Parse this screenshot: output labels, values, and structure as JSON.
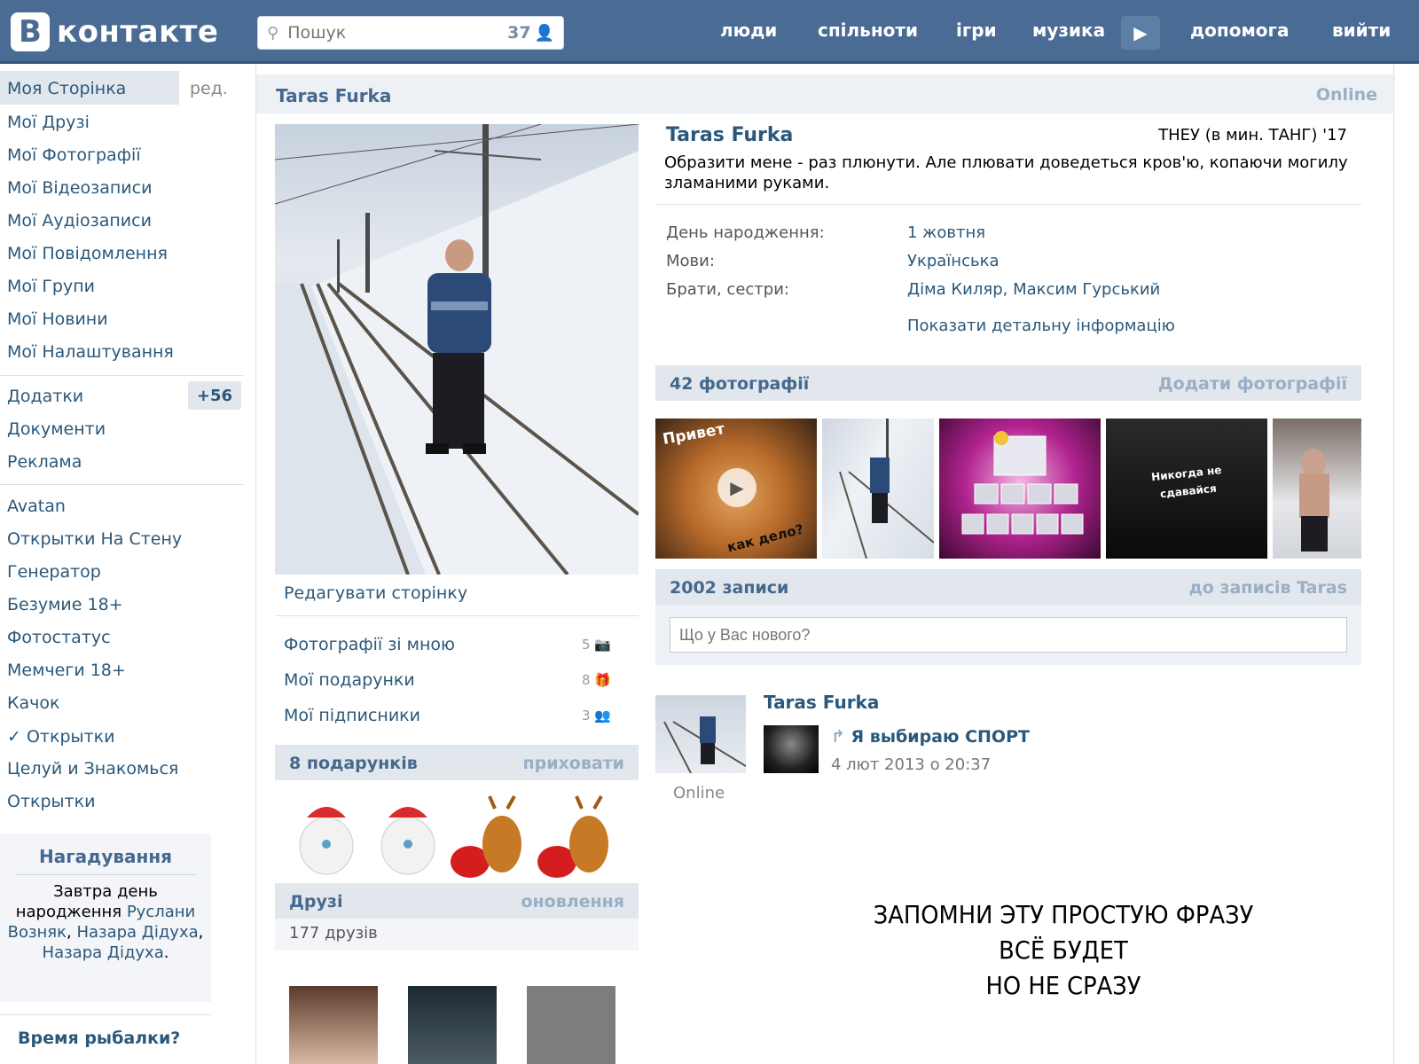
{
  "header": {
    "logo_letter": "В",
    "logo_text": "контакте",
    "search_placeholder": "Пошук",
    "search_count": "37",
    "nav": [
      "люди",
      "спільноти",
      "ігри",
      "музика",
      "допомога",
      "вийти"
    ]
  },
  "sidebar": {
    "items": [
      "Моя Сторінка",
      "Мої Друзі",
      "Мої Фотографії",
      "Мої Відеозаписи",
      "Мої Аудіозаписи",
      "Мої Повідомлення",
      "Мої Групи",
      "Мої Новини",
      "Мої Налаштування"
    ],
    "edit_label": "ред.",
    "apps": [
      "Додатки",
      "Документи",
      "Реклама"
    ],
    "apps_badge": "+56",
    "extra": [
      "Avatan",
      "Открытки На Стену",
      "Генератор",
      "Безумие 18+",
      "Фотостатус",
      "Мемчеги 18+",
      "Качок",
      "✓ Открытки",
      "Целуй и Знакомься",
      "Открытки"
    ],
    "reminder": {
      "title": "Нагадування",
      "text_1": "Завтра день народження",
      "name_1": "Руслани Возняк",
      "sep": ", ",
      "name_2": "Назара Дідуха",
      "name_3": "Назара Дідуха",
      "end": "."
    },
    "bottom_title": "Время рыбалки?"
  },
  "profile": {
    "title": "Taras Furka",
    "online": "Online",
    "name": "Taras Furka",
    "education": "ТНЕУ (в мин. ТАНГ) '17",
    "status": "Образити мене - раз плюнути. Але плювати доведеться кров'ю, копаючи могилу зламаними руками.",
    "info": [
      {
        "label": "День народження:",
        "value": "1 жовтня"
      },
      {
        "label": "Мови:",
        "value": "Українська"
      },
      {
        "label": "Брати, сестри:",
        "value": "Діма Киляр, Максим Гурський"
      }
    ],
    "show_more": "Показати детальну інформацію",
    "edit_page": "Редагувати сторінку",
    "links": [
      {
        "label": "Фотографії зі мною",
        "count": "5"
      },
      {
        "label": "Мої подарунки",
        "count": "8"
      },
      {
        "label": "Мої підписники",
        "count": "3"
      }
    ],
    "gifts": {
      "title": "8 подарунків",
      "action": "приховати"
    },
    "friends": {
      "title": "Друзі",
      "action": "оновлення",
      "count": "177 друзів"
    }
  },
  "photos": {
    "title": "42 фотографії",
    "action": "Додати фотографії",
    "thumb1_text": "Привет",
    "thumb1_text2": "как дело?",
    "thumb4_text": "Никогда не сдавайся"
  },
  "wall": {
    "title": "2002 записи",
    "action": "до записів Taras",
    "input_placeholder": "Що у Вас нового?",
    "post": {
      "author": "Taras Furka",
      "online": "Online",
      "shared": "Я выбираю СПОРТ",
      "time": "4 лют 2013 о 20:37"
    }
  },
  "quote": {
    "line1": "ЗАПОМНИ ЭТУ ПРОСТУЮ ФРАЗУ",
    "line2": "ВСЁ БУДЕТ",
    "line3": "НО НЕ СРАЗУ"
  },
  "colors": {
    "header": "#4a6c94",
    "link": "#2b587a",
    "block_header": "#e1e7ed"
  }
}
